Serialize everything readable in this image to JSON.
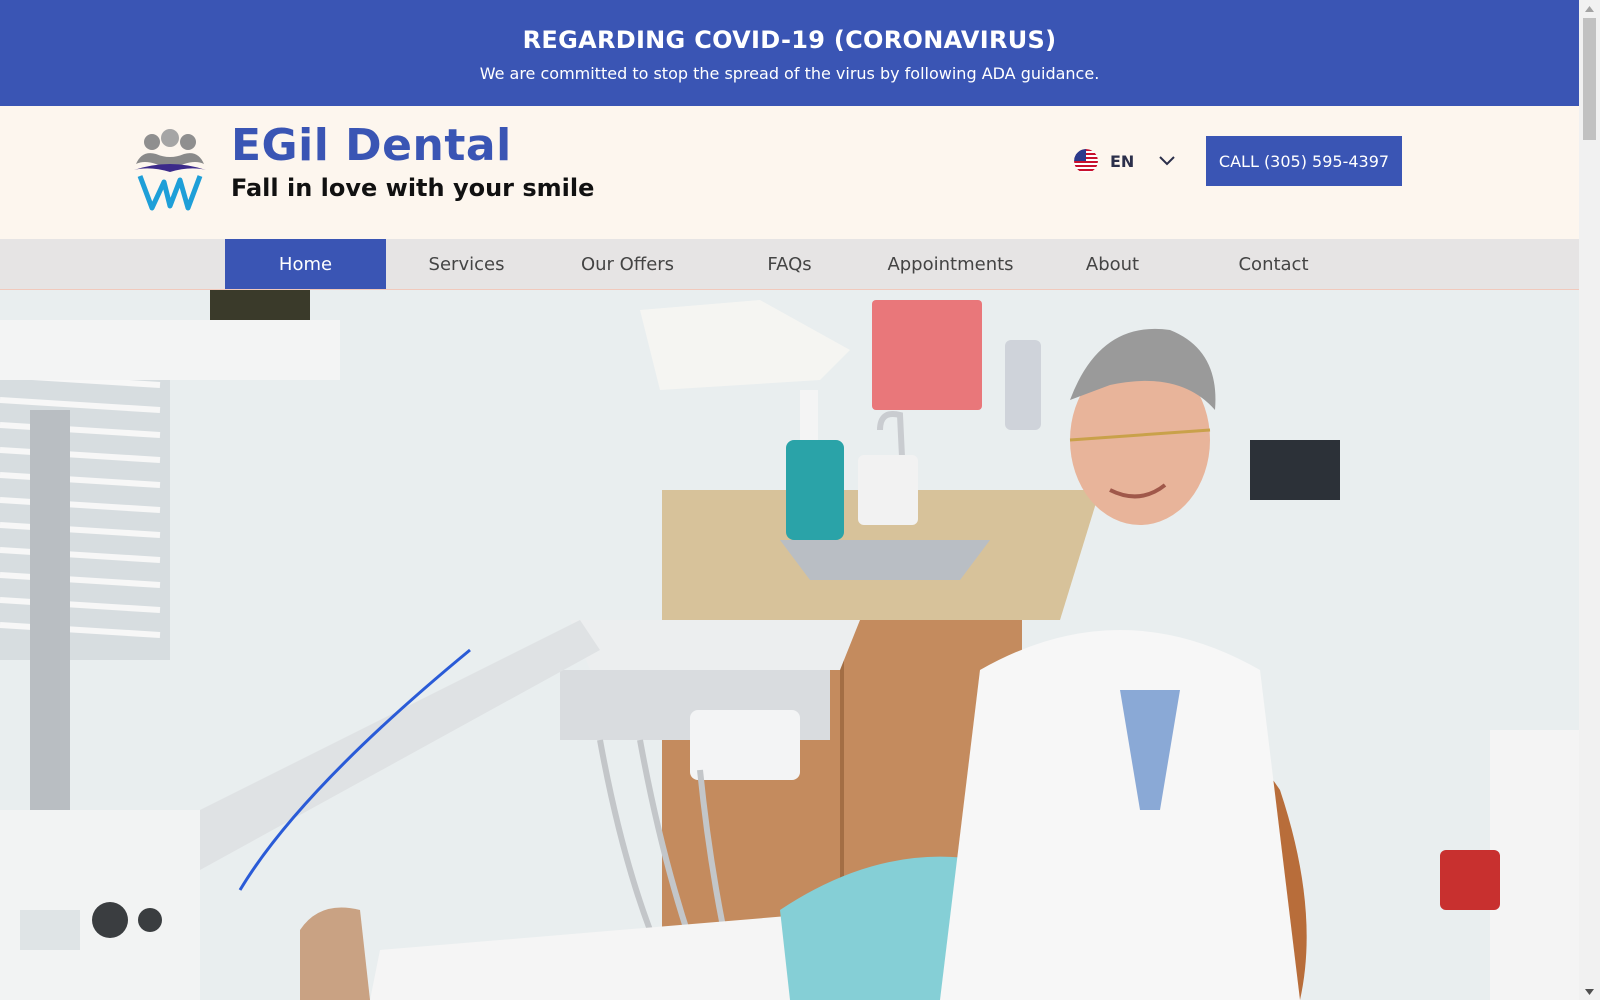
{
  "banner": {
    "title": "REGARDING COVID-19 (CORONAVIRUS)",
    "subtitle": "We are committed to stop the spread of the virus by following ADA guidance."
  },
  "header": {
    "brand_name": "EGil Dental",
    "tagline": "Fall in love with your smile",
    "language": {
      "code": "EN",
      "flag_icon": "us-flag-icon",
      "dropdown_icon": "chevron-down-icon"
    },
    "call_button": "CALL (305) 595-4397"
  },
  "nav": {
    "items": [
      {
        "label": "Home",
        "active": true
      },
      {
        "label": "Services"
      },
      {
        "label": "Our Offers"
      },
      {
        "label": "FAQs"
      },
      {
        "label": "Appointments"
      },
      {
        "label": "About"
      },
      {
        "label": "Contact"
      }
    ]
  },
  "colors": {
    "accent": "#3a55b4",
    "header_bg": "#fdf6ee",
    "nav_bg": "#e6e4e4"
  }
}
